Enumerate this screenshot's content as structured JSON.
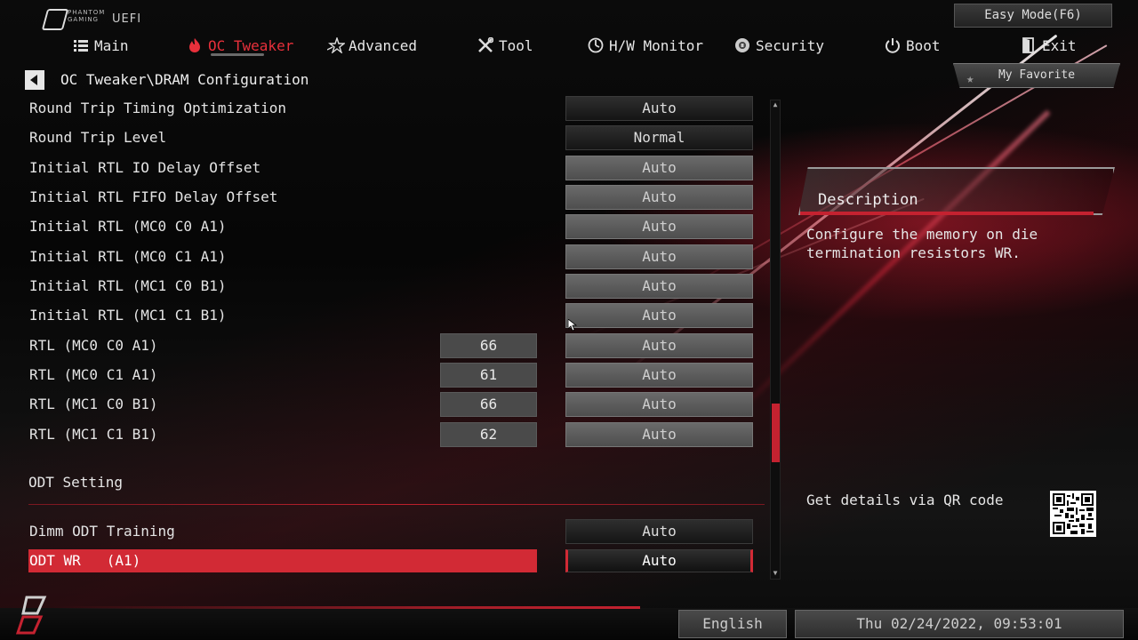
{
  "header": {
    "logo_brand_line1": "PHANTOM",
    "logo_brand_line2": "GAMING",
    "logo_uefi": "UEFI",
    "easy_mode_label": "Easy Mode(F6)"
  },
  "nav": {
    "items": [
      {
        "label": "Main",
        "icon": "list-icon"
      },
      {
        "label": "OC Tweaker",
        "icon": "flame-icon",
        "active": true
      },
      {
        "label": "Advanced",
        "icon": "star-icon"
      },
      {
        "label": "Tool",
        "icon": "tools-icon"
      },
      {
        "label": "H/W Monitor",
        "icon": "monitor-icon"
      },
      {
        "label": "Security",
        "icon": "shield-icon"
      },
      {
        "label": "Boot",
        "icon": "power-icon"
      },
      {
        "label": "Exit",
        "icon": "exit-icon"
      }
    ]
  },
  "breadcrumb": "OC Tweaker\\DRAM Configuration",
  "my_favorite_label": "My Favorite",
  "settings": [
    {
      "label": "Round Trip Timing Optimization",
      "current": "",
      "value": "Auto",
      "dim": false
    },
    {
      "label": "Round Trip Level",
      "current": "",
      "value": "Normal",
      "dim": false
    },
    {
      "label": "Initial RTL IO Delay Offset",
      "current": "",
      "value": "Auto",
      "dim": true
    },
    {
      "label": "Initial RTL FIFO Delay Offset",
      "current": "",
      "value": "Auto",
      "dim": true
    },
    {
      "label": "Initial RTL (MC0 C0 A1)",
      "current": "",
      "value": "Auto",
      "dim": true
    },
    {
      "label": "Initial RTL (MC0 C1 A1)",
      "current": "",
      "value": "Auto",
      "dim": true
    },
    {
      "label": "Initial RTL (MC1 C0 B1)",
      "current": "",
      "value": "Auto",
      "dim": true
    },
    {
      "label": "Initial RTL (MC1 C1 B1)",
      "current": "",
      "value": "Auto",
      "dim": true
    },
    {
      "label": "RTL (MC0 C0 A1)",
      "current": "66",
      "value": "Auto",
      "dim": true
    },
    {
      "label": "RTL (MC0 C1 A1)",
      "current": "61",
      "value": "Auto",
      "dim": true
    },
    {
      "label": "RTL (MC1 C0 B1)",
      "current": "66",
      "value": "Auto",
      "dim": true
    },
    {
      "label": "RTL (MC1 C1 B1)",
      "current": "62",
      "value": "Auto",
      "dim": true
    }
  ],
  "odt_section": {
    "title": "ODT Setting",
    "rows": [
      {
        "label": "Dimm ODT Training",
        "value": "Auto"
      },
      {
        "label": "ODT WR   (A1)",
        "value": "Auto",
        "selected": true
      }
    ]
  },
  "description": {
    "title": "Description",
    "text": "Configure the memory on die termination resistors WR."
  },
  "qr_text": "Get details via QR code",
  "footer": {
    "language": "English",
    "datetime": "Thu 02/24/2022, 09:53:01"
  },
  "colors": {
    "accent": "#d22a35",
    "active_nav": "#e8303b"
  }
}
